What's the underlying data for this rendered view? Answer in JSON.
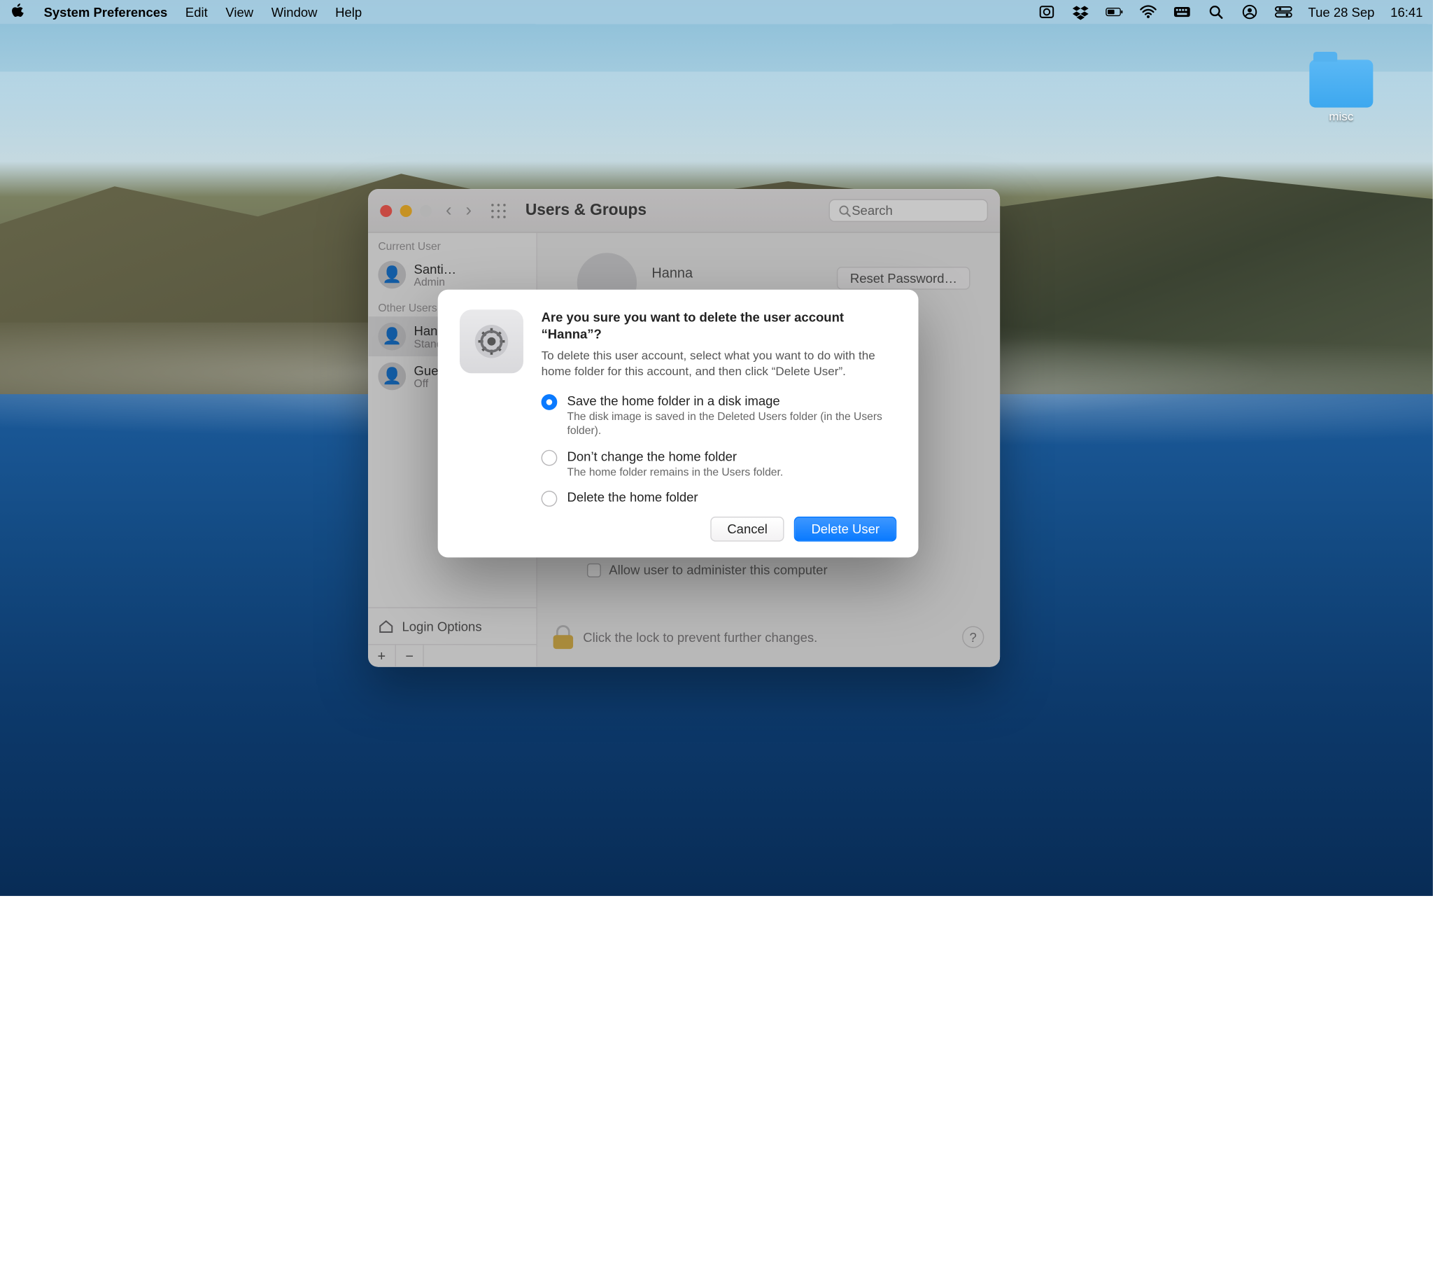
{
  "menubar": {
    "app": "System Preferences",
    "items": [
      "Edit",
      "View",
      "Window",
      "Help"
    ],
    "date": "Tue 28 Sep",
    "time": "16:41"
  },
  "desktop": {
    "folder_label": "misc"
  },
  "window": {
    "title": "Users & Groups",
    "search_placeholder": "Search",
    "sidebar": {
      "current_label": "Current User",
      "other_label": "Other Users",
      "users": [
        {
          "name": "Santi…",
          "role": "Admin"
        },
        {
          "name": "Hanna",
          "role": "Standard"
        },
        {
          "name": "Guest",
          "role": "Off"
        }
      ],
      "login_options": "Login Options"
    },
    "main": {
      "user_name": "Hanna",
      "reset_password": "Reset Password…",
      "admin_checkbox": "Allow user to administer this computer",
      "lock_text": "Click the lock to prevent further changes."
    }
  },
  "sheet": {
    "title": "Are you sure you want to delete the user account “Hanna”?",
    "subtitle": "To delete this user account, select what you want to do with the home folder for this account, and then click “Delete User”.",
    "options": [
      {
        "label": "Save the home folder in a disk image",
        "desc": "The disk image is saved in the Deleted Users folder (in the Users folder).",
        "checked": true
      },
      {
        "label": "Don’t change the home folder",
        "desc": "The home folder remains in the Users folder.",
        "checked": false
      },
      {
        "label": "Delete the home folder",
        "desc": "",
        "checked": false
      }
    ],
    "cancel": "Cancel",
    "confirm": "Delete User"
  }
}
